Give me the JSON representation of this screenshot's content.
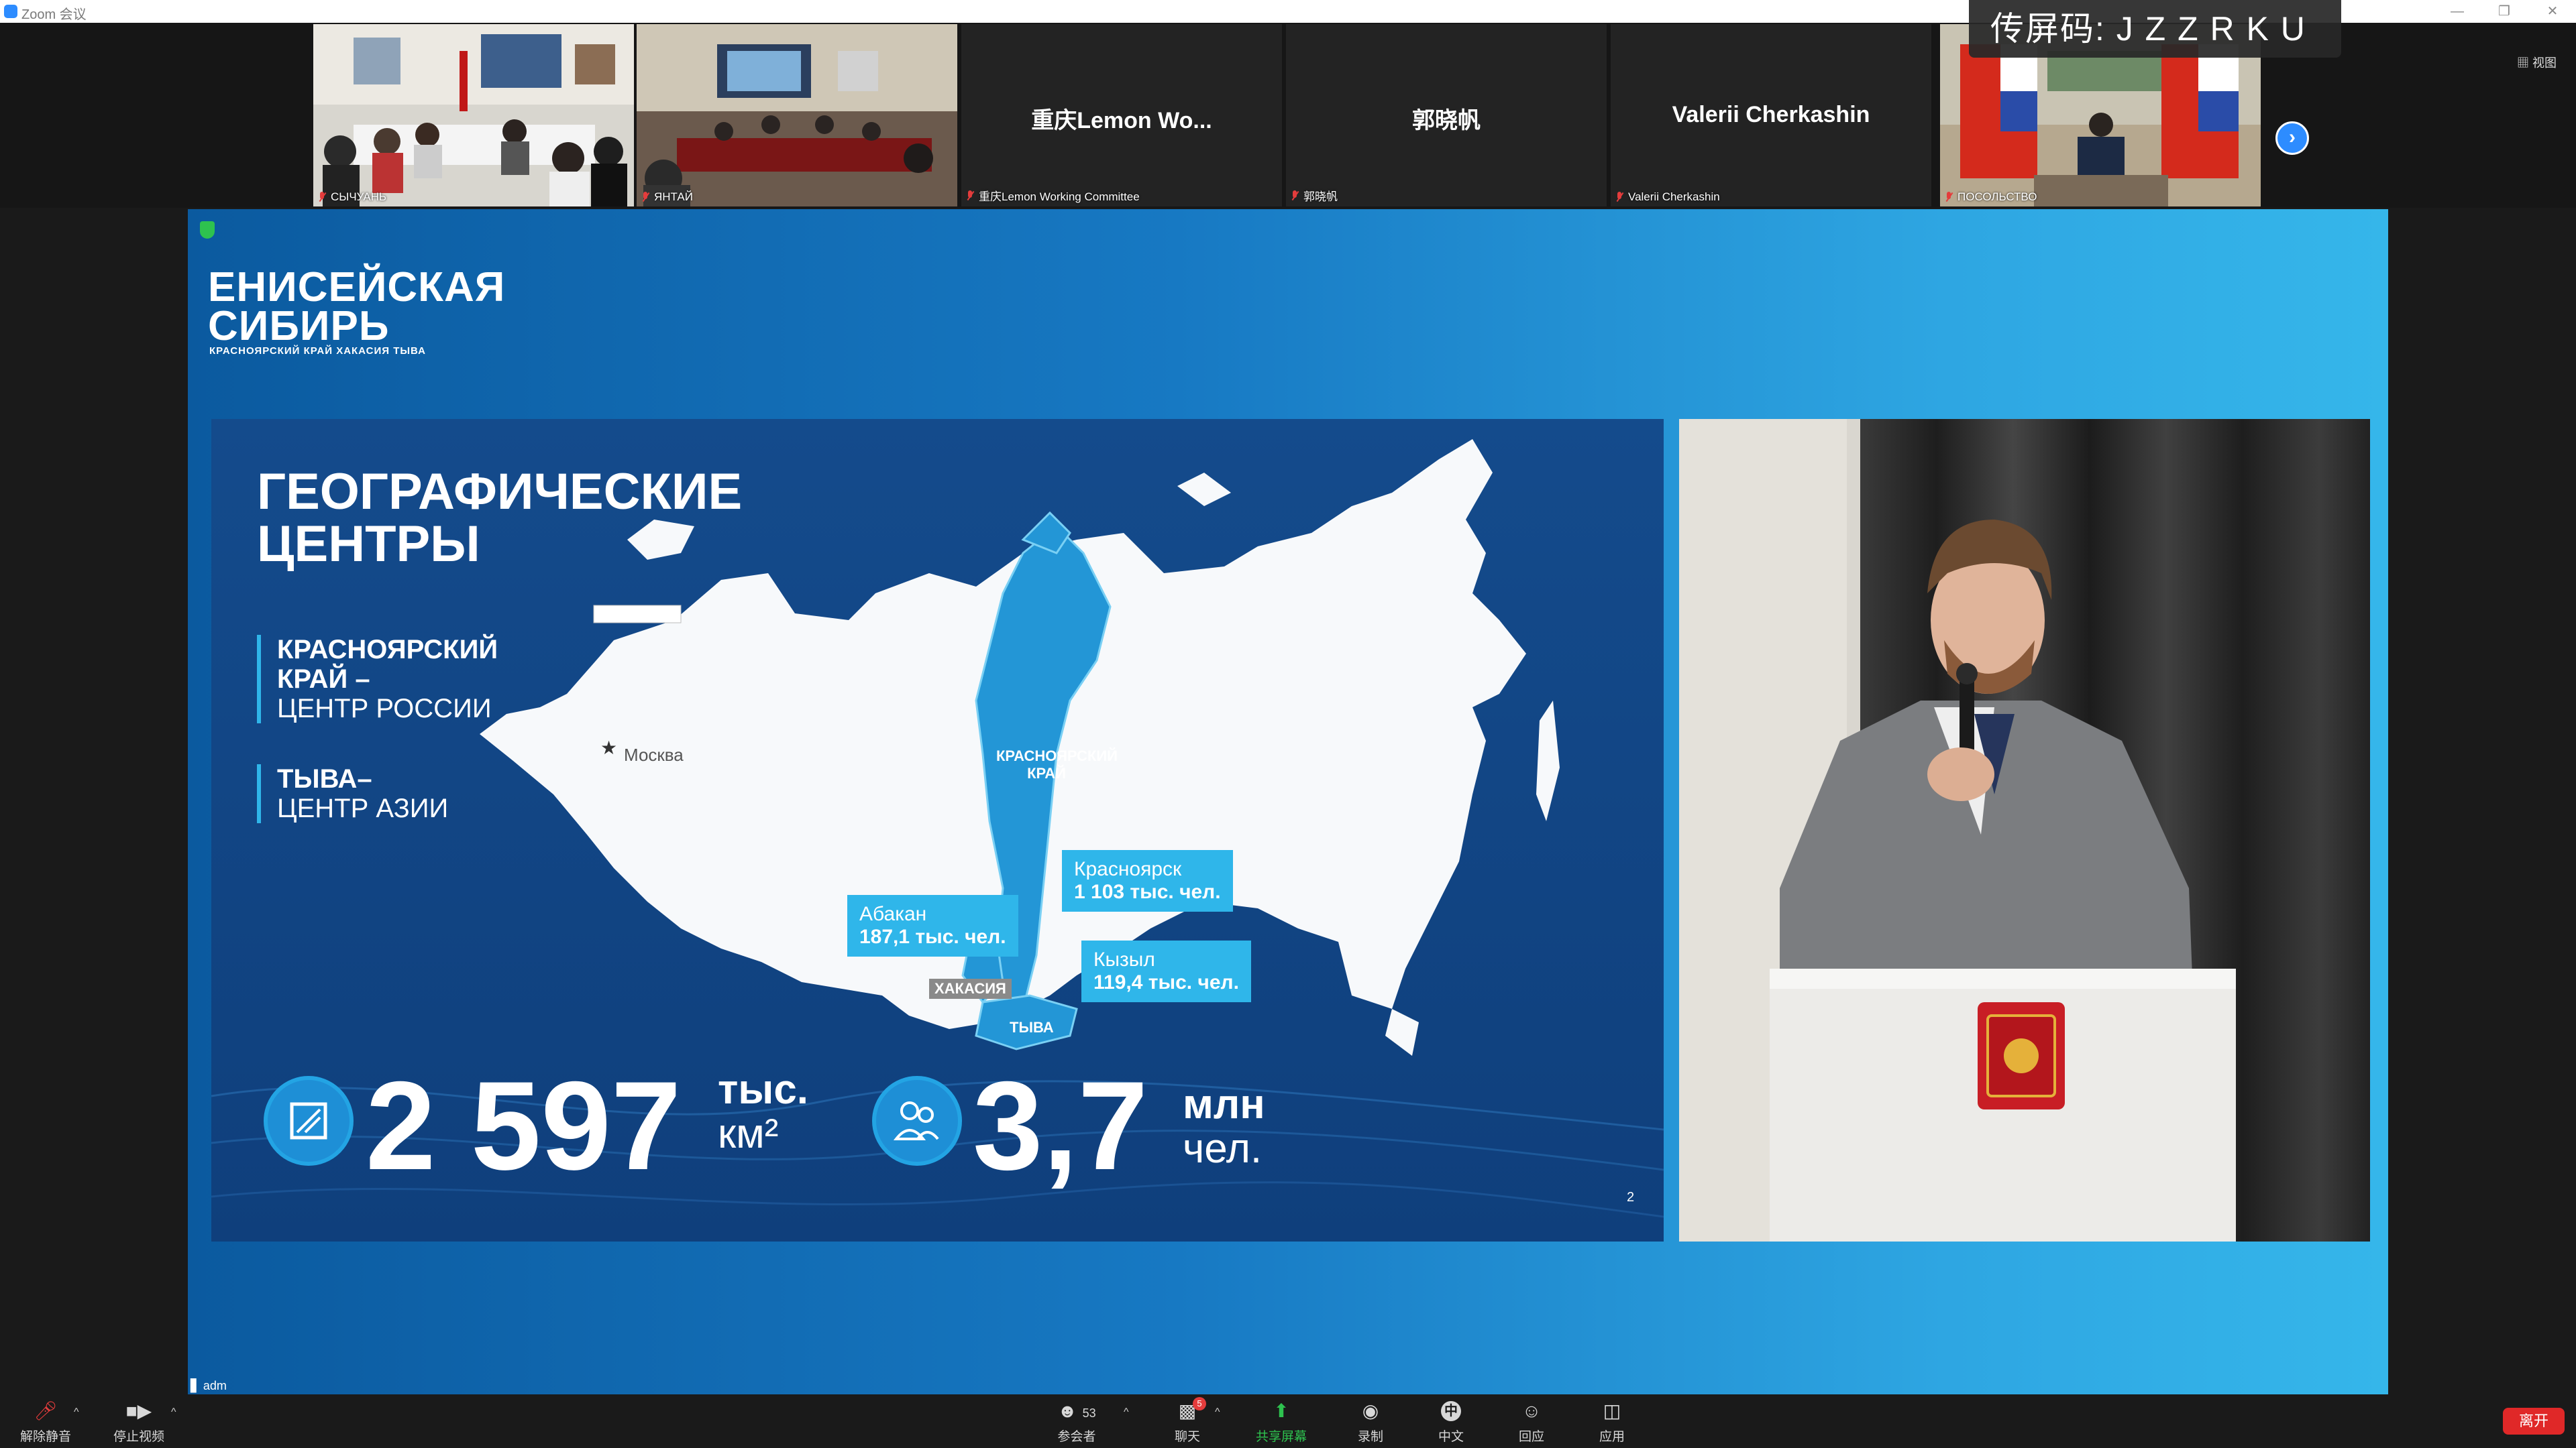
{
  "window": {
    "title": "Zoom 会议",
    "view_label": "视图"
  },
  "share_code": "传屏码: J Z Z R K U",
  "participants": [
    {
      "caption": "СЫЧУАНЬ",
      "big_name": ""
    },
    {
      "caption": "ЯНТАЙ",
      "big_name": ""
    },
    {
      "caption": "重庆Lemon Working Committee",
      "big_name": "重庆Lemon  Wo..."
    },
    {
      "caption": "郭晓帆",
      "big_name": "郭晓帆"
    },
    {
      "caption": "Valerii Cherkashin",
      "big_name": "Valerii  Cherkashin"
    },
    {
      "caption": "ПОСОЛЬСТВО",
      "big_name": ""
    }
  ],
  "slide": {
    "logo_line1": "ЕНИСЕЙСКАЯ",
    "logo_line2": "СИБИРЬ",
    "logo_sub": "КРАСНОЯРСКИЙ КРАЙ  ХАКАСИЯ  ТЫВА",
    "title_line1": "ГЕОГРАФИЧЕСКИЕ",
    "title_line2": "ЦЕНТРЫ",
    "bullet1_bold1": "КРАСНОЯРСКИЙ",
    "bullet1_bold2": "КРАЙ –",
    "bullet1_rest": "ЦЕНТР РОССИИ",
    "bullet2_bold": "ТЫВА–",
    "bullet2_rest": "ЦЕНТР АЗИИ",
    "map_moscow": "Москва",
    "map_region": "КРАСНОЯРСКИЙ КРАЙ",
    "map_khakasia": "ХАКАСИЯ",
    "map_tyva": "ТЫВА",
    "callout_abakan_city": "Абакан",
    "callout_abakan_pop": "187,1 тыс. чел.",
    "callout_krsk_city": "Красноярск",
    "callout_krsk_pop": "1 103 тыс. чел.",
    "callout_kyzyl_city": "Кызыл",
    "callout_kyzyl_pop": "119,4 тыс. чел.",
    "stat_area_value": "2 597",
    "stat_area_unit1": "тыс.",
    "stat_area_unit2": "км²",
    "stat_pop_value": "3,7",
    "stat_pop_unit1": "млн",
    "stat_pop_unit2": "чел.",
    "page_number": "2"
  },
  "share_label": "adm",
  "toolbar": {
    "unmute": "解除静音",
    "stop_video": "停止视频",
    "participants": "参会者",
    "participants_count": "53",
    "chat": "聊天",
    "chat_badge": "5",
    "share_screen": "共享屏幕",
    "record": "录制",
    "language": "中文",
    "language_icon_char": "中",
    "reactions": "回应",
    "apps": "应用",
    "leave": "离开"
  },
  "colors": {
    "accent": "#2d8cff",
    "share_green": "#2ec24f",
    "leave_red": "#e02828",
    "slide_cyan": "#2fb6ea"
  }
}
